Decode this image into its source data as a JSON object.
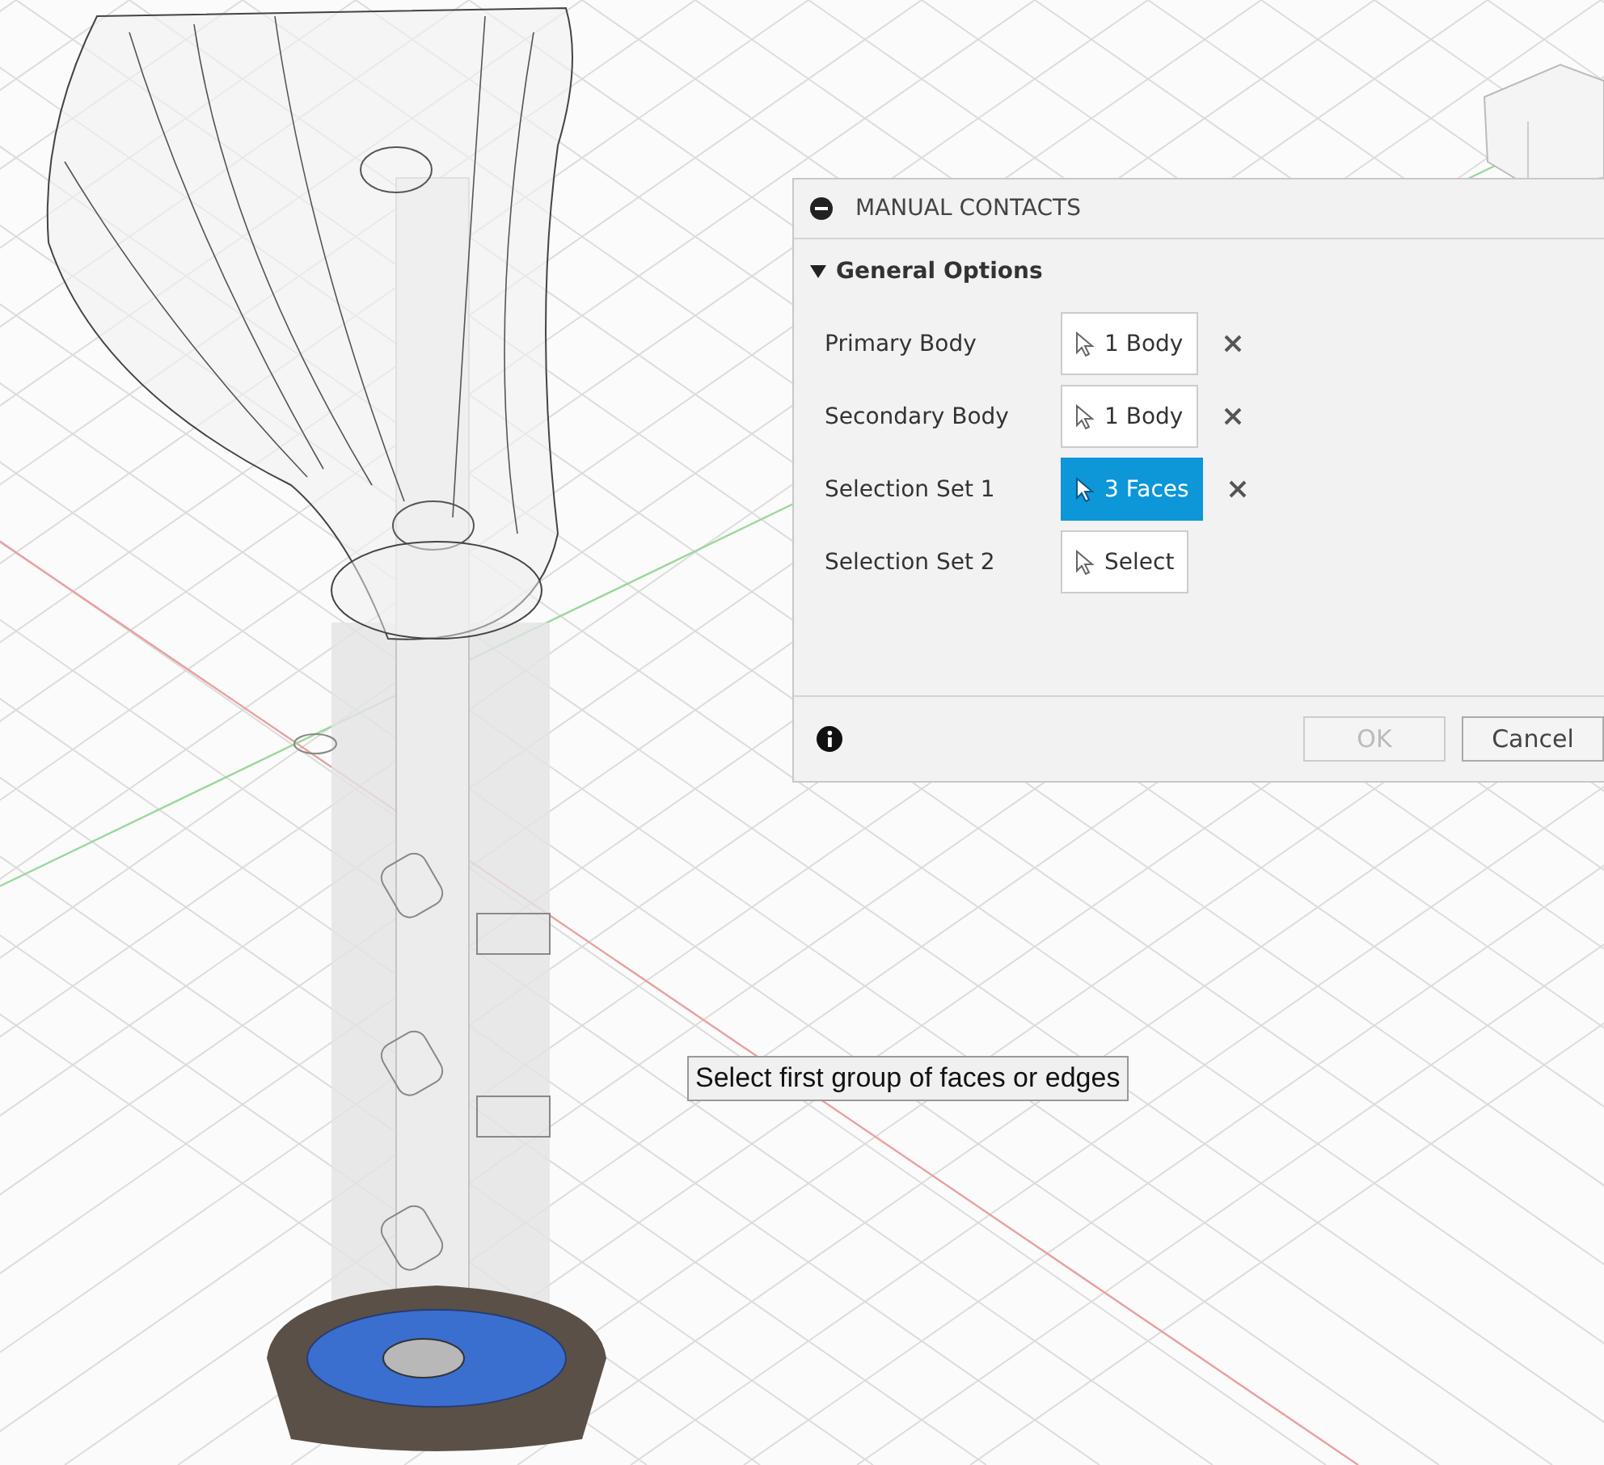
{
  "dialog": {
    "title": "MANUAL CONTACTS",
    "section": {
      "title": "General Options",
      "expanded": true
    },
    "rows": [
      {
        "label": "Primary Body",
        "value": "1 Body",
        "selected": false,
        "clearable": true
      },
      {
        "label": "Secondary Body",
        "value": "1 Body",
        "selected": false,
        "clearable": true
      },
      {
        "label": "Selection Set 1",
        "value": "3 Faces",
        "selected": true,
        "clearable": true
      },
      {
        "label": "Selection Set 2",
        "value": "Select",
        "selected": false,
        "clearable": false
      }
    ],
    "buttons": [
      {
        "label": "OK",
        "disabled": true
      },
      {
        "label": "Cancel",
        "disabled": false
      }
    ]
  },
  "tooltip": "Select first group of faces or edges"
}
